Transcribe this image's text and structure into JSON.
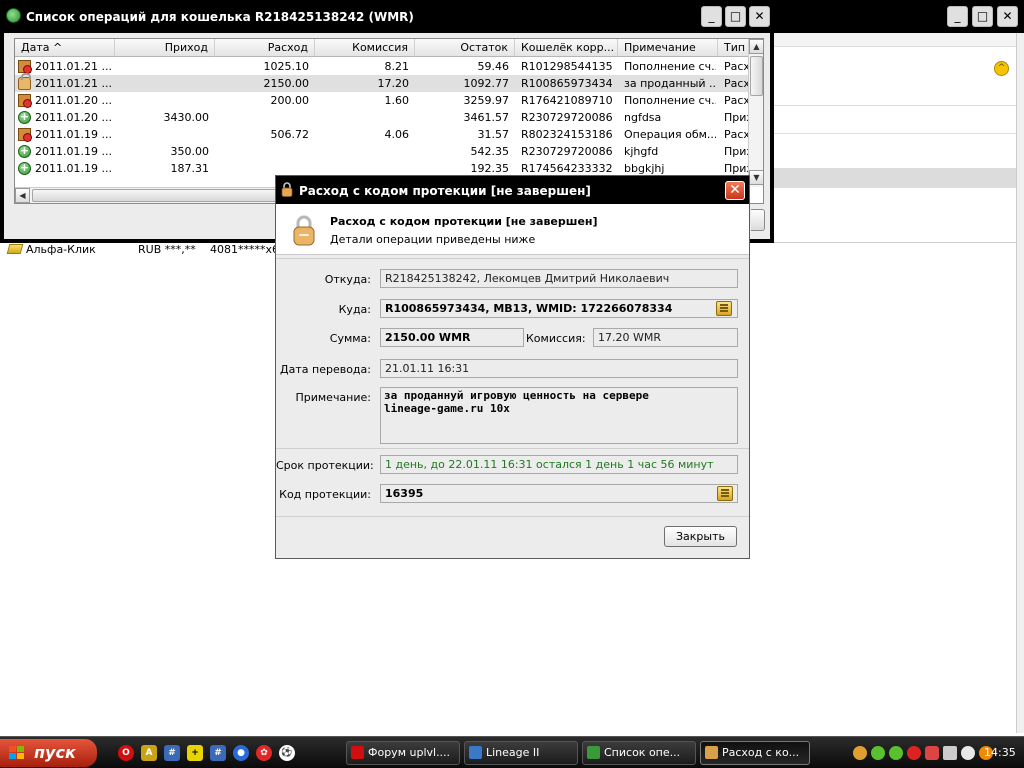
{
  "ops_window": {
    "title": "Список операций для кошелька R218425138242 (WMR)",
    "columns": [
      "Дата ^",
      "Приход",
      "Расход",
      "Комиссия",
      "Остаток",
      "Кошелёк корр...",
      "Примечание",
      "Тип"
    ],
    "rows": [
      {
        "date": "2011.01.21 ...",
        "income": "",
        "expense": "1025.10",
        "fee": "8.21",
        "balance": "59.46",
        "wallet": "R101298544135",
        "note": "Пополнение сч...",
        "type": "Расх",
        "icon": "lockbox-icon"
      },
      {
        "date": "2011.01.21 ...",
        "income": "",
        "expense": "2150.00",
        "fee": "17.20",
        "balance": "1092.77",
        "wallet": "R100865973434",
        "note": "за проданный ...",
        "type": "Расх",
        "icon": "lock-icon"
      },
      {
        "date": "2011.01.20 ...",
        "income": "",
        "expense": "200.00",
        "fee": "1.60",
        "balance": "3259.97",
        "wallet": "R176421089710",
        "note": "Пополнение сч...",
        "type": "Расх",
        "icon": "lockbox-icon"
      },
      {
        "date": "2011.01.20 ...",
        "income": "3430.00",
        "expense": "",
        "fee": "",
        "balance": "3461.57",
        "wallet": "R230729720086",
        "note": "ngfdsa",
        "type": "Прих",
        "icon": "plus-icon"
      },
      {
        "date": "2011.01.19 ...",
        "income": "",
        "expense": "506.72",
        "fee": "4.06",
        "balance": "31.57",
        "wallet": "R802324153186",
        "note": "Операция обм...",
        "type": "Расх",
        "icon": "lockbox-icon"
      },
      {
        "date": "2011.01.19 ...",
        "income": "350.00",
        "expense": "",
        "fee": "",
        "balance": "542.35",
        "wallet": "R230729720086",
        "note": "kjhgfd",
        "type": "Прих",
        "icon": "plus-icon"
      },
      {
        "date": "2011.01.19 ...",
        "income": "187.31",
        "expense": "",
        "fee": "",
        "balance": "192.35",
        "wallet": "R174564233332",
        "note": "bbgkjhj",
        "type": "Прих",
        "icon": "plus-icon"
      }
    ],
    "selected_row": 1,
    "window_controls": {
      "minimize": "_",
      "maximize": "□",
      "close": "✕"
    }
  },
  "background_window": {
    "row": {
      "name": "Альфа-Клик",
      "currency": "RUB ***,**",
      "account": "4081*****x6"
    },
    "warning_glyph": "^"
  },
  "dialog": {
    "title": "Расход с кодом протекции [не завершен]",
    "header_title": "Расход с кодом протекции [не завершен]",
    "header_subtitle": "Детали операции приведены ниже",
    "labels": {
      "from": "Откуда:",
      "to": "Куда:",
      "amount": "Сумма:",
      "fee": "Комиссия:",
      "date": "Дата перевода:",
      "note": "Примечание:",
      "protection_term": "Срок протекции:",
      "protection_code": "Код протекции:"
    },
    "values": {
      "from": "R218425138242, Лекомцев Дмитрий Николаевич",
      "to": "R100865973434, MB13, WMID: 172266078334",
      "amount": "2150.00 WMR",
      "fee": "17.20 WMR",
      "date": "21.01.11 16:31",
      "note": "за проданнуй игровую ценность на сервере\nlineage-game.ru 10x",
      "protection_term": "1 день, до 22.01.11 16:31 остался 1 день 1 час 56 минут",
      "protection_code": "16395"
    },
    "close_button": "Закрыть",
    "close_glyph": "✕"
  },
  "taskbar": {
    "start_label": "пуск",
    "tasks": [
      {
        "label": "Форум uplvl....",
        "icon": "opera-icon",
        "color": "#d01010"
      },
      {
        "label": "Lineage II",
        "icon": "lineage-icon",
        "color": "#3a78c8"
      },
      {
        "label": "Список опе...",
        "icon": "webmoney-icon",
        "color": "#3a9a3a"
      },
      {
        "label": "Расход с ко...",
        "icon": "lock-icon",
        "color": "#d8a04a"
      }
    ],
    "active_task": 3,
    "clock": "14:35"
  },
  "colors": {
    "start_button": "#c73a20",
    "protection_term_text": "#1f7a1f",
    "dialog_close": "#d6452a",
    "selected_row": "#e0e0e0"
  }
}
